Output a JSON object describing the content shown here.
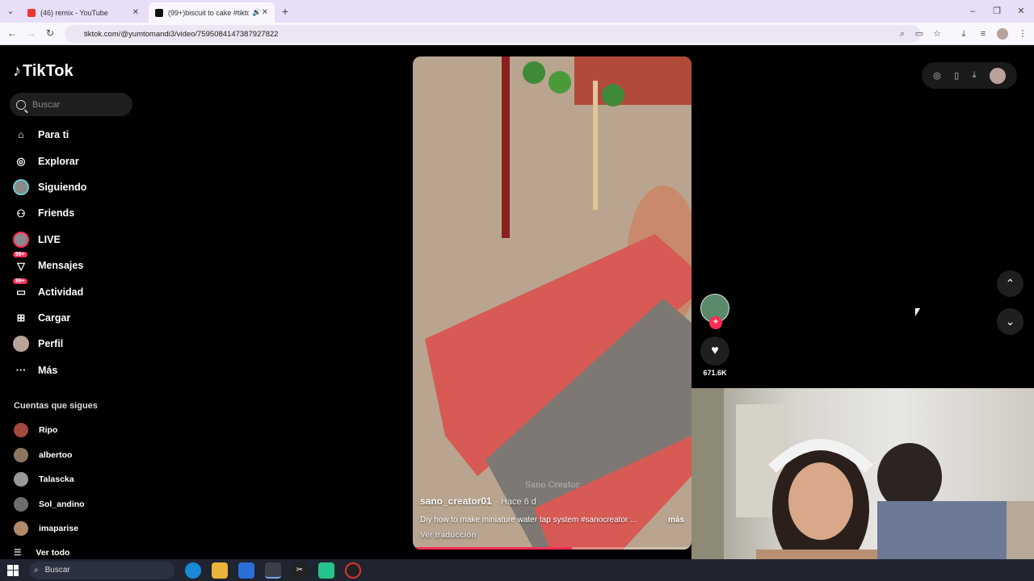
{
  "browser": {
    "tabs": [
      {
        "title": "(46) remix - YouTube",
        "active": false
      },
      {
        "title": "(99+)biscuit to cake #tiktok",
        "active": true
      }
    ],
    "url": "tiktok.com/@yumtomandi3/video/7595084147387927822"
  },
  "sidebar": {
    "logo": "TikTok",
    "search_placeholder": "Buscar",
    "menu": [
      {
        "label": "Para ti",
        "icon": "home-icon"
      },
      {
        "label": "Explorar",
        "icon": "compass-icon"
      },
      {
        "label": "Siguiendo",
        "icon": "following-avatar"
      },
      {
        "label": "Friends",
        "icon": "friends-icon"
      },
      {
        "label": "LIVE",
        "icon": "live-icon"
      },
      {
        "label": "Mensajes",
        "icon": "messages-icon",
        "badge": "99+"
      },
      {
        "label": "Actividad",
        "icon": "activity-icon",
        "badge": "99+"
      },
      {
        "label": "Cargar",
        "icon": "upload-icon"
      },
      {
        "label": "Perfil",
        "icon": "profile-avatar"
      },
      {
        "label": "Más",
        "icon": "more-icon"
      }
    ],
    "following_title": "Cuentas que sigues",
    "following": [
      "Ripo",
      "albertoo",
      "Talascka",
      "Sol_andino",
      "imaparise"
    ],
    "see_all": "Ver todo"
  },
  "video": {
    "username": "sano_creator01",
    "time": "· Hace 6 d",
    "description": "Diy how to make miniature water tap system #sanocreator ...",
    "more": "más",
    "translate": "Ver traducción",
    "watermark": "Sano Creator",
    "likes": "671.6K",
    "progress": 0.57
  },
  "taskbar": {
    "search": "Buscar"
  }
}
